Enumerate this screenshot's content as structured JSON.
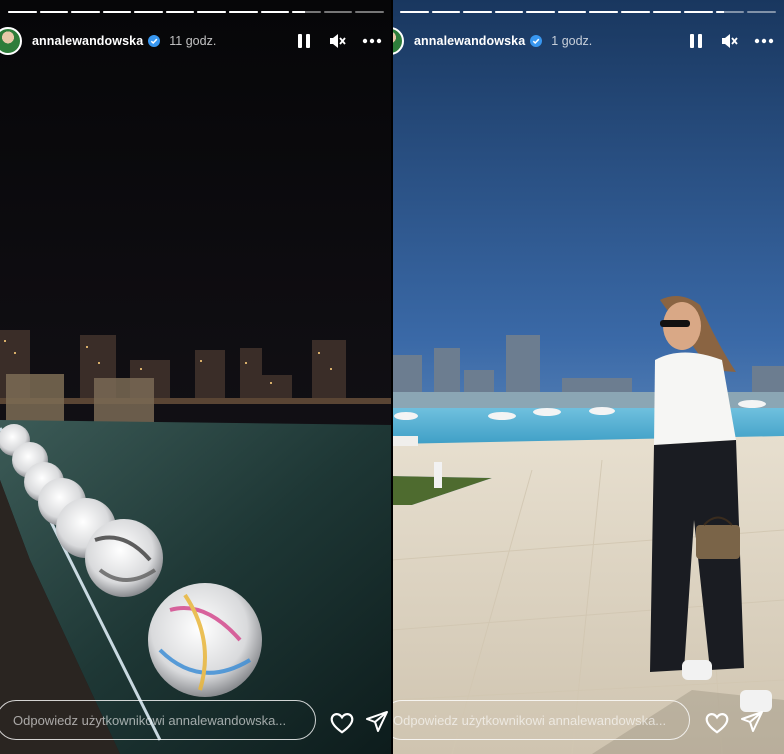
{
  "stories": [
    {
      "username": "annalewandowska",
      "time": "11 godz.",
      "reply_placeholder": "Odpowiedz użytkownikowi annalewandowska...",
      "progress": {
        "segments": 12,
        "completed": 9,
        "current_fill": 0.45
      }
    },
    {
      "username": "annalewandowska",
      "time": "1 godz.",
      "reply_placeholder": "Odpowiedz użytkownikowi annalewandowska...",
      "progress": {
        "segments": 12,
        "completed": 10,
        "current_fill": 0.3
      }
    }
  ],
  "icons": {
    "pause": "pause-icon",
    "mute": "speaker-muted-icon",
    "more": "more-options-icon",
    "verified": "verified-badge-icon",
    "like": "heart-icon",
    "share": "send-icon"
  },
  "colors": {
    "verified_blue": "#3897f0",
    "night_sky": "#0b0b0e",
    "day_sky": "#3f6fb0",
    "pool_water": "#4fb0d6"
  }
}
